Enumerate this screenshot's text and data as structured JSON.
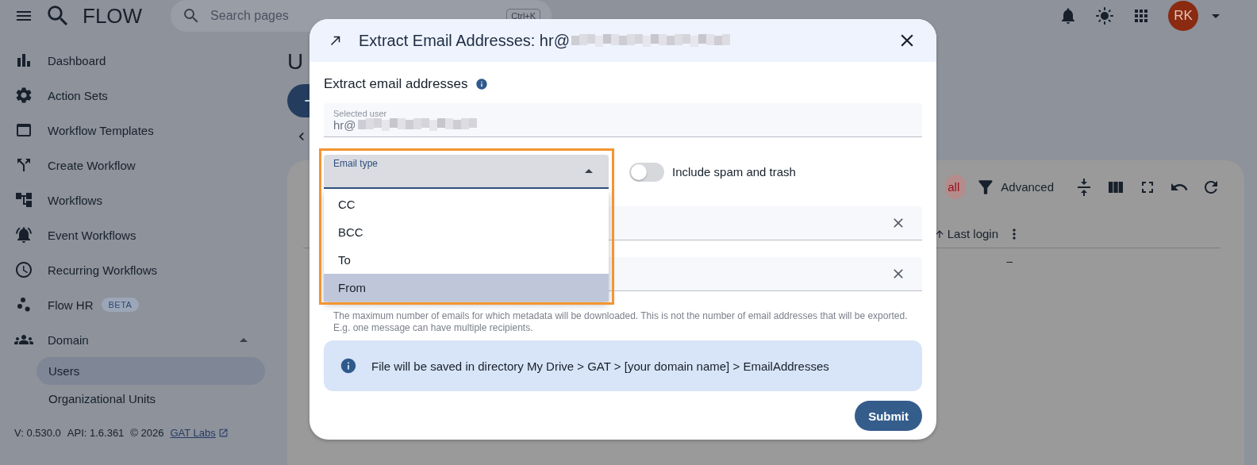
{
  "header": {
    "logo": "FLOW",
    "search": {
      "placeholder": "Search pages",
      "shortcut": "Ctrl+K"
    },
    "avatar": "RK"
  },
  "sidebar": {
    "items": [
      {
        "label": "Dashboard"
      },
      {
        "label": "Action Sets"
      },
      {
        "label": "Workflow Templates"
      },
      {
        "label": "Create Workflow"
      },
      {
        "label": "Workflows"
      },
      {
        "label": "Event Workflows"
      },
      {
        "label": "Recurring Workflows"
      },
      {
        "label": "Flow HR",
        "badge": "BETA"
      },
      {
        "label": "Domain",
        "expanded": true,
        "children": [
          {
            "label": "Users",
            "selected": true
          },
          {
            "label": "Organizational Units",
            "selected": false
          }
        ]
      }
    ],
    "footer": {
      "version": "V: 0.530.0",
      "api": "API: 1.6.361",
      "copyright": "© 2026",
      "link": "GAT Labs"
    }
  },
  "main": {
    "title": "U",
    "toolbar": {
      "chip": "all",
      "advanced": "Advanced"
    },
    "table": {
      "column": "Last login",
      "cell": "–"
    }
  },
  "dialog": {
    "title": "Extract Email Addresses: hr@",
    "heading": "Extract email addresses",
    "selected_user": {
      "label": "Selected user",
      "value": "hr@"
    },
    "email_type": {
      "label": "Email type",
      "expanded": true,
      "options": [
        {
          "label": "CC",
          "selected": false
        },
        {
          "label": "BCC",
          "selected": false
        },
        {
          "label": "To",
          "selected": false
        },
        {
          "label": "From",
          "selected": true
        }
      ]
    },
    "toggle": {
      "label": "Include spam and trash",
      "on": false
    },
    "fields": [
      {
        "clearable": true
      },
      {
        "clearable": true
      }
    ],
    "helper": "The maximum number of emails for which metadata will be downloaded. This is not the number of email addresses that will be exported. E.g. one message can have multiple recipients.",
    "info": "File will be saved in directory My Drive > GAT > [your domain name] > EmailAddresses",
    "submit": "Submit"
  }
}
